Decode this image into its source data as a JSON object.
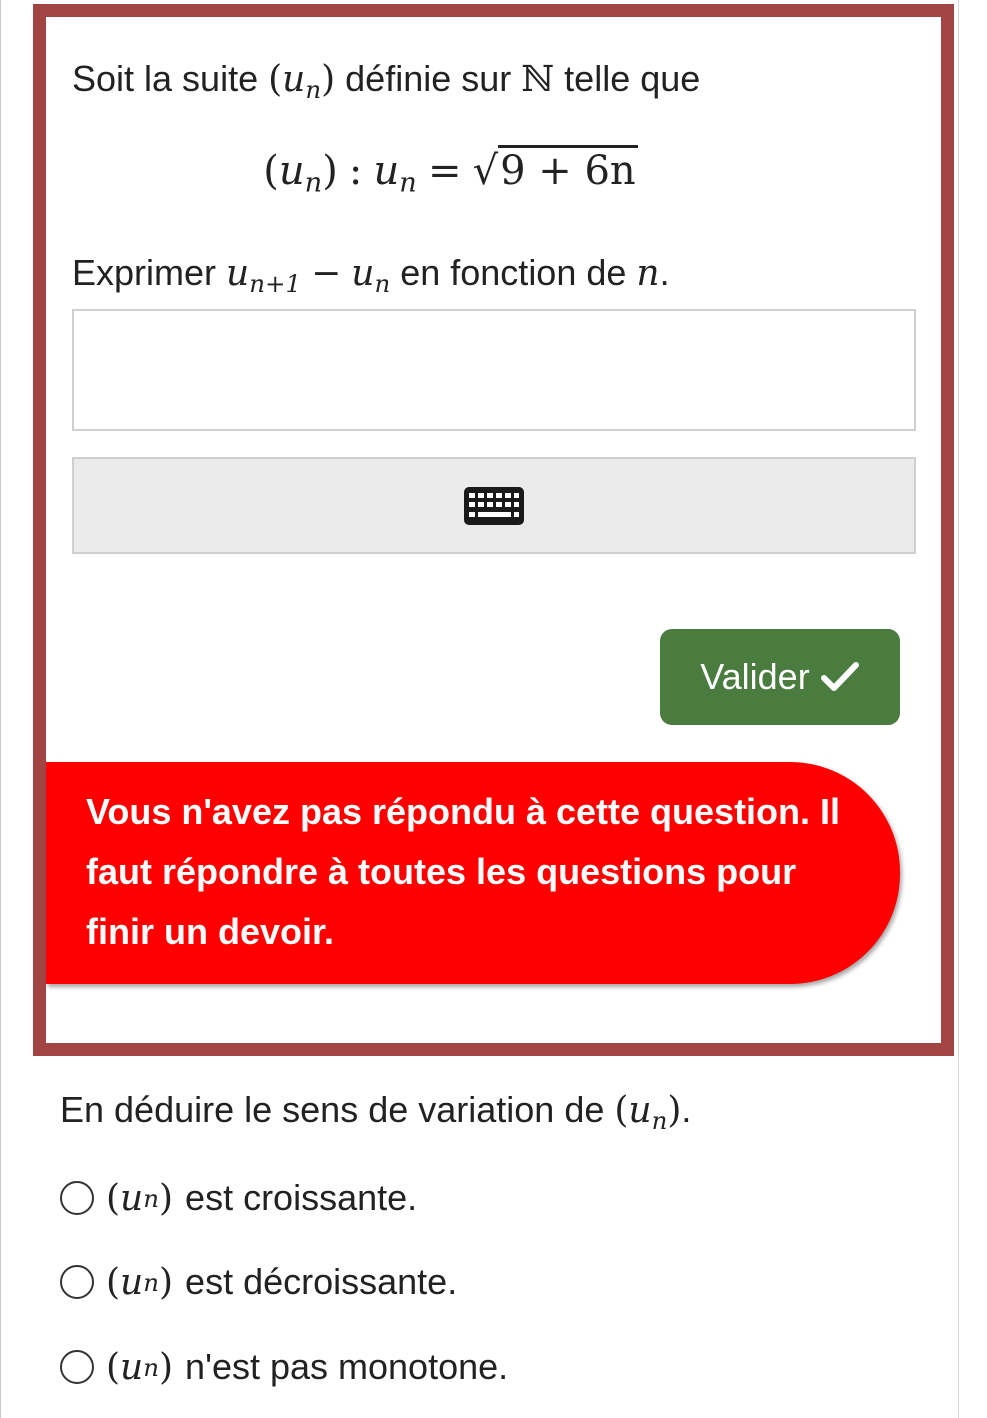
{
  "question": {
    "intro_before": "Soit la suite ",
    "intro_after": " définie sur ",
    "set_symbol": "ℕ",
    "intro_end": " telle que",
    "sequence_var": "u",
    "index": "n",
    "formula_colon": ":",
    "formula_equals": "=",
    "radicand": "9 + 6n",
    "prompt_before": "Exprimer ",
    "prompt_index_next": "n+1",
    "prompt_minus": "−",
    "prompt_after": " en fonction de ",
    "prompt_var": "n",
    "prompt_end": ".",
    "validate_label": "Valider",
    "warning_text": "Vous n'avez pas répondu à cette question. Il faut répondre à toutes les questions pour finir un devoir."
  },
  "followup": {
    "prompt_before": "En déduire le sens de variation de ",
    "prompt_end": ".",
    "options": [
      {
        "text": "est croissante."
      },
      {
        "text": "est décroissante."
      },
      {
        "text": "n'est pas monotone."
      }
    ]
  },
  "colors": {
    "frame": "#a34444",
    "validate_button": "#4a7b3f",
    "warning": "#ff0000"
  },
  "icons": {
    "keyboard": "keyboard-icon",
    "validate": "check-icon",
    "radio": "radio-icon"
  }
}
